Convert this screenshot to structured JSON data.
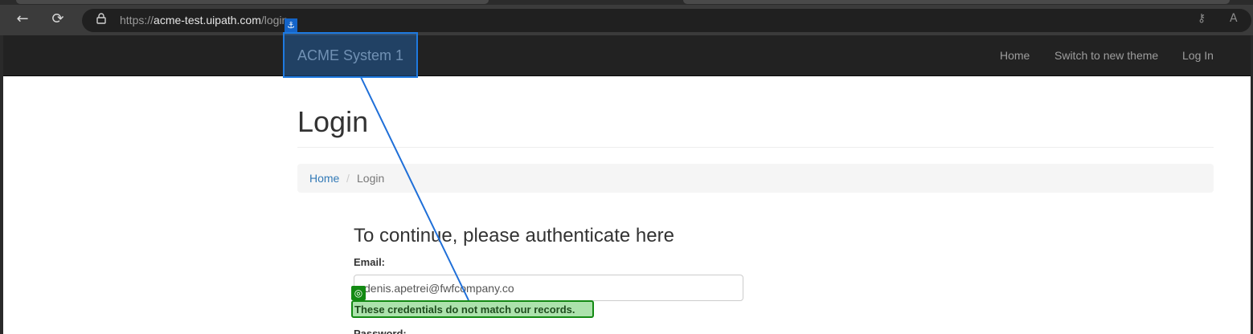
{
  "browser": {
    "url_prefix": "https://",
    "url_host": "acme-test.uipath.com",
    "url_path": "/login",
    "back_icon": "←",
    "reload_icon": "⟳",
    "key_icon": "⚷",
    "read_aloud_icon": "A"
  },
  "navbar": {
    "brand": "ACME System 1",
    "links": [
      "Home",
      "Switch to new theme",
      "Log In"
    ]
  },
  "page": {
    "title": "Login",
    "breadcrumb": {
      "home": "Home",
      "separator": "/",
      "current": "Login"
    },
    "form_heading": "To continue, please authenticate here",
    "email_label": "Email:",
    "email_value": "denis.apetrei@fwfcompany.co",
    "password_label": "Password:"
  },
  "annotations": {
    "anchor_icon": "⚓",
    "target_icon": "◎",
    "target_text": "These credentials do not match our records."
  },
  "colors": {
    "anchor": "#1f7ae0",
    "target": "#138a13",
    "link": "#337ab7",
    "navbar_bg": "#222222"
  }
}
